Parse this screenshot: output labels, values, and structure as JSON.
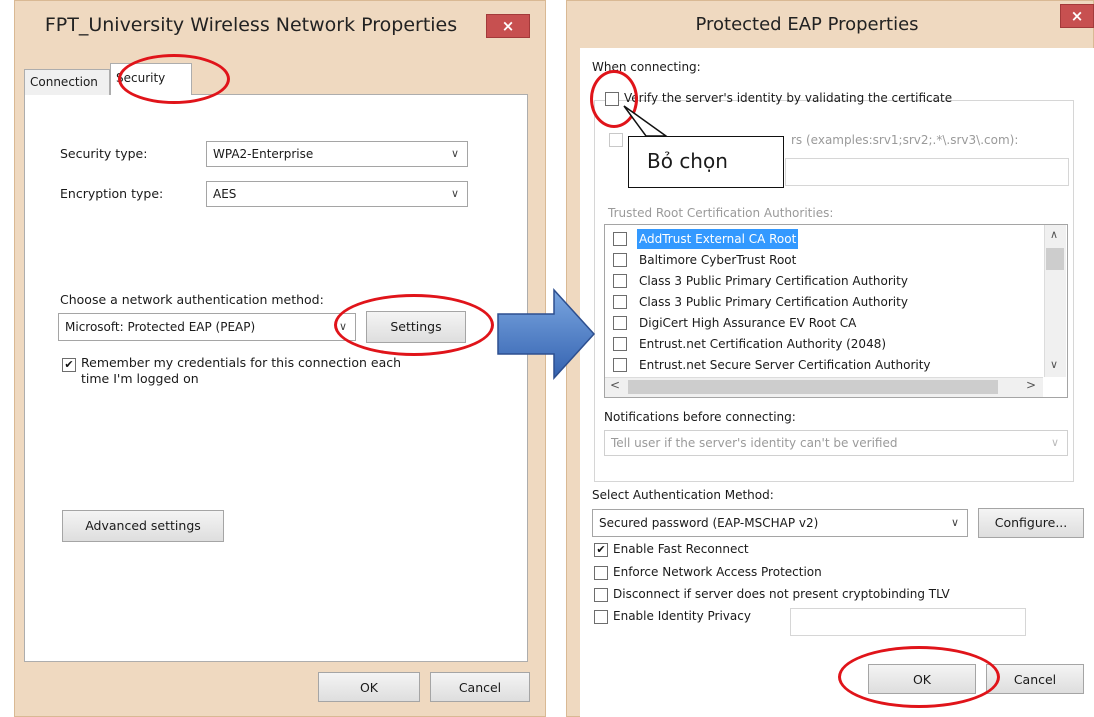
{
  "left_dialog": {
    "title": "FPT_University Wireless Network Properties",
    "close_label": "×",
    "tabs": [
      {
        "label": "Connection",
        "active": false
      },
      {
        "label": "Security",
        "active": true
      }
    ],
    "security_type_label": "Security type:",
    "security_type_value": "WPA2-Enterprise",
    "encryption_type_label": "Encryption type:",
    "encryption_type_value": "AES",
    "auth_method_label": "Choose a network authentication method:",
    "auth_method_value": "Microsoft: Protected EAP (PEAP)",
    "settings_button": "Settings",
    "remember_line1": "Remember my credentials for this connection each",
    "remember_line2": "time I'm logged on",
    "remember_checked": true,
    "advanced_button": "Advanced settings",
    "ok_button": "OK",
    "cancel_button": "Cancel"
  },
  "right_dialog": {
    "title": "Protected EAP Properties",
    "close_label": "×",
    "when_connecting": "When connecting:",
    "verify_identity": "Verify the server's identity by validating the certificate",
    "verify_checked": false,
    "connect_servers_partial": "rs (examples:srv1;srv2;.*\\.srv3\\.com):",
    "trusted_root_label": "Trusted Root Certification Authorities:",
    "certificates": [
      {
        "name": "AddTrust External CA Root",
        "selected": true
      },
      {
        "name": "Baltimore CyberTrust Root",
        "selected": false
      },
      {
        "name": "Class 3 Public Primary Certification Authority",
        "selected": false
      },
      {
        "name": "Class 3 Public Primary Certification Authority",
        "selected": false
      },
      {
        "name": "DigiCert High Assurance EV Root CA",
        "selected": false
      },
      {
        "name": "Entrust.net Certification Authority (2048)",
        "selected": false
      },
      {
        "name": "Entrust.net Secure Server Certification Authority",
        "selected": false
      }
    ],
    "scroll_left": "<",
    "scroll_right": ">",
    "notifications_label": "Notifications before connecting:",
    "notifications_value": "Tell user if the server's identity can't be verified",
    "select_auth_label": "Select Authentication Method:",
    "auth_method_value": "Secured password (EAP-MSCHAP v2)",
    "configure_button": "Configure...",
    "options": [
      {
        "label": "Enable Fast Reconnect",
        "checked": true
      },
      {
        "label": "Enforce Network Access Protection",
        "checked": false
      },
      {
        "label": "Disconnect if server does not present cryptobinding TLV",
        "checked": false
      },
      {
        "label": "Enable Identity Privacy",
        "checked": false
      }
    ],
    "ok_button": "OK",
    "cancel_button": "Cancel"
  },
  "annotation": {
    "callout_text": "Bỏ chọn",
    "ring_color": "#e0141a",
    "arrow_color": "#4a7fc8"
  },
  "glyphs": {
    "chevron_down": "∨",
    "check": "✔",
    "scroll_up": "∧",
    "scroll_down": "∨"
  }
}
